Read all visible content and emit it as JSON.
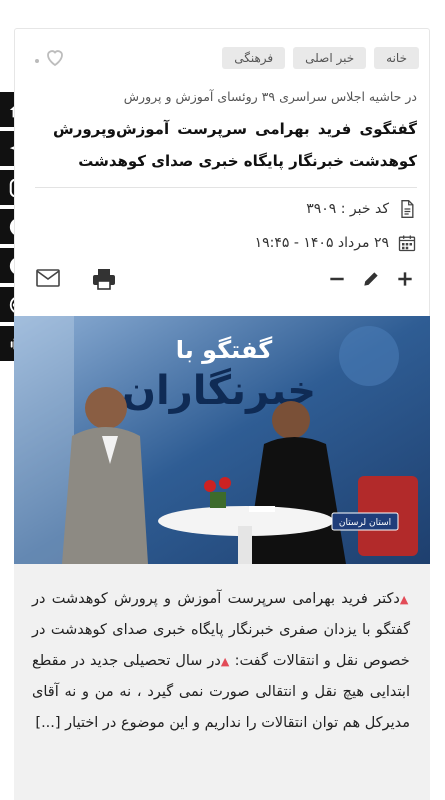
{
  "tags": [
    "خانه",
    "خبر اصلی",
    "فرهنگی"
  ],
  "icons": {
    "heart": "heart-icon",
    "document": "document-icon",
    "calendar": "calendar-icon",
    "mail": "mail-icon",
    "print": "print-icon",
    "plus": "plus-icon",
    "pencil": "pencil-icon",
    "minus": "minus-icon"
  },
  "article": {
    "subtitle": "در حاشیه اجلاس سراسری ۳۹ روئسای آموزش و پرورش",
    "title": "گفتگوی فرید بهرامی سرپرست آموزش‌وپرورش کوهدشت خبرنگار پایگاه خبری صدای کوهدشت",
    "code": "کد خبر : ۳۹۰۹",
    "date": "۲۹ مرداد ۱۴۰۵ - ۱۹:۴۵",
    "lead_part1": "دکتر فرید بهرامی سرپرست آموزش و پرورش کوهدشت در گفتگو با یزدان صفری خبرنگار پایگاه خبری صدای کوهدشت در خصوص نقل و انتقالات گفت:",
    "lead_part2": "در سال تحصیلی جدید در مقطع ابتدایی هیچ نقل و انتقالی صورت نمی گیرد ، نه من و نه آقای مدیرکل هم توان انتقالات را نداریم و این موضوع در اختیار [...]"
  },
  "photo": {
    "banner_small": "گفتگو با",
    "banner_large": "خبرنگاران",
    "caption": "استان لرستان"
  },
  "colors": {
    "accent": "#e24b57",
    "social_bg": "#111111",
    "photo_bg": "#2f5d94"
  },
  "social": [
    "home-icon",
    "telegram-icon",
    "instagram-icon",
    "eitaa-icon",
    "eitaa-e-icon",
    "aparat-icon",
    "android-icon"
  ]
}
